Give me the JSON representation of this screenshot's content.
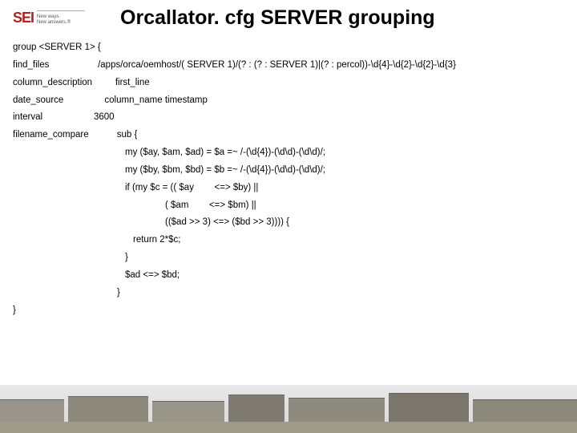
{
  "logo": {
    "brand": "SEI",
    "tag1": "New ways.",
    "tag2": "New answers.®"
  },
  "title": "Orcallator. cfg SERVER grouping",
  "lines": {
    "l1": "group <SERVER 1> {",
    "l2": "find_files                   /apps/orca/oemhost/( SERVER 1)/(? : (? : SERVER 1)|(? : percol))-\\d{4}-\\d{2}-\\d{2}-\\d{3}",
    "l3": "column_description         first_line",
    "l4": "date_source                column_name timestamp",
    "l5": "interval                    3600",
    "l6": "filename_compare           sub {",
    "l7": "my ($ay, $am, $ad) = $a =~ /-(\\d{4})-(\\d\\d)-(\\d\\d)/;",
    "l8": "my ($by, $bm, $bd) = $b =~ /-(\\d{4})-(\\d\\d)-(\\d\\d)/;",
    "l9": "if (my $c = (( $ay        <=> $by) ||",
    "l10": "( $am        <=> $bm) ||",
    "l11": "(($ad >> 3) <=> ($bd >> 3)))) {",
    "l12": "return 2*$c;",
    "l13": "}",
    "l14": "$ad <=> $bd;",
    "l15": "}",
    "l16": "}"
  }
}
